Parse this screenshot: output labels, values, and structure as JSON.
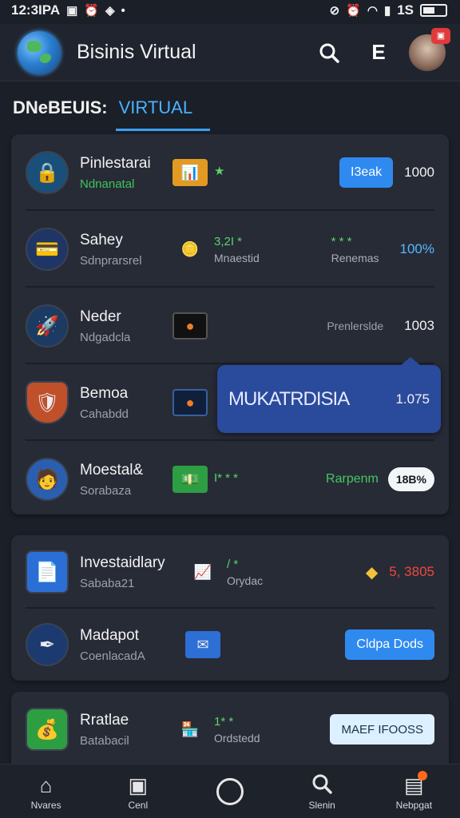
{
  "status_bar": {
    "time": "12:3IPA",
    "right_text": "1S"
  },
  "app_bar": {
    "title": "Bisinis Virtual",
    "menu_glyph": "E"
  },
  "tabs": {
    "prefix": "DNeBEUIS:",
    "active": "VIRTUAL"
  },
  "rows": [
    {
      "name": "Pinlestarai",
      "sub": "Ndnanatal",
      "sub_color": "green",
      "mid_text": "",
      "mid_accent": "",
      "status": "",
      "button": "I3eak",
      "value": "1000",
      "icon": "lock-icon",
      "accent_color": "#2f8af0"
    },
    {
      "name": "Sahey",
      "sub": "Sdnprarsrel",
      "mid_accent": "3,2I *",
      "mid_text": "Mnaestid",
      "status": "Renemas",
      "status_accent": "* * *",
      "value": "100%",
      "icon": "card-icon"
    },
    {
      "name": "Neder",
      "sub": "Ndgadcla",
      "mid_text": "",
      "status": "Prenlerslde",
      "value": "1003",
      "icon": "rocket-icon"
    },
    {
      "name": "Bemoa",
      "sub": "Cahabdd",
      "mid_text": "",
      "status": "",
      "value": "",
      "icon": "shield-icon"
    },
    {
      "name": "Moestal&",
      "sub": "Sorabaza",
      "mid_accent": "I* * *",
      "mid_text": "",
      "status": "Rarpenm",
      "value": "18B%",
      "icon": "person-icon"
    }
  ],
  "tooltip": {
    "title": "MUKATRDISIA",
    "value": "1.075"
  },
  "rows2": [
    {
      "name": "Investaidlary",
      "sub": "Sababa21",
      "mid_accent": "/ *",
      "mid_text": "Orydac",
      "value": "5, 3805",
      "icon": "document-icon"
    },
    {
      "name": "Madapot",
      "sub": "CoenlacadA",
      "button": "Cldpa Dods",
      "icon": "pen-icon"
    }
  ],
  "rows3": [
    {
      "name": "Rratlae",
      "sub": "Batabacil",
      "mid_accent": "1* *",
      "mid_text": "Ordstedd",
      "button": "MAEF IFOOSS",
      "icon": "money-icon"
    }
  ],
  "bottom_nav": [
    {
      "label": "Nvares",
      "icon": "home-icon"
    },
    {
      "label": "Cenl",
      "icon": "box-icon"
    },
    {
      "label": "",
      "icon": "circle-icon"
    },
    {
      "label": "Slenin",
      "icon": "search-icon"
    },
    {
      "label": "Nebpgat",
      "icon": "inbox-icon"
    }
  ],
  "colors": {
    "accent": "#2f8af0",
    "tab_accent": "#4ab3ff",
    "positive": "#3fc45b",
    "negative": "#f0473f",
    "tooltip": "#2a4a9c"
  }
}
